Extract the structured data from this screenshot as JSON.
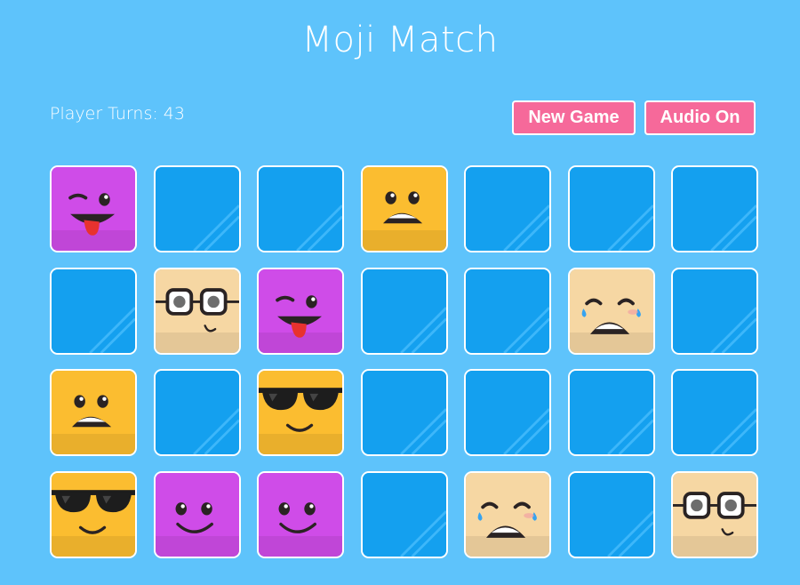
{
  "app": {
    "title": "Moji Match"
  },
  "status": {
    "turns_label": "Player Turns: 43"
  },
  "controls": {
    "new_game_label": "New Game",
    "audio_label": "Audio On"
  },
  "colors": {
    "background": "#5ec3fb",
    "card_back": "#14a0ef",
    "button": "#f6699a",
    "purple": "#cf4ce8",
    "yellow": "#fbbd30",
    "tan": "#f6d7a3"
  },
  "board": {
    "columns": 7,
    "rows": 4,
    "cards": [
      {
        "face": "wink-tongue",
        "revealed": true
      },
      {
        "face": "hidden",
        "revealed": false
      },
      {
        "face": "hidden",
        "revealed": false
      },
      {
        "face": "shocked",
        "revealed": true
      },
      {
        "face": "hidden",
        "revealed": false
      },
      {
        "face": "hidden",
        "revealed": false
      },
      {
        "face": "hidden",
        "revealed": false
      },
      {
        "face": "hidden",
        "revealed": false
      },
      {
        "face": "nerd-glasses",
        "revealed": true
      },
      {
        "face": "wink-tongue",
        "revealed": true
      },
      {
        "face": "hidden",
        "revealed": false
      },
      {
        "face": "hidden",
        "revealed": false
      },
      {
        "face": "crying",
        "revealed": true
      },
      {
        "face": "hidden",
        "revealed": false
      },
      {
        "face": "shocked",
        "revealed": true
      },
      {
        "face": "hidden",
        "revealed": false
      },
      {
        "face": "sunglasses",
        "revealed": true
      },
      {
        "face": "hidden",
        "revealed": false
      },
      {
        "face": "hidden",
        "revealed": false
      },
      {
        "face": "hidden",
        "revealed": false
      },
      {
        "face": "hidden",
        "revealed": false
      },
      {
        "face": "sunglasses",
        "revealed": true
      },
      {
        "face": "smile",
        "revealed": true
      },
      {
        "face": "smile",
        "revealed": true
      },
      {
        "face": "hidden",
        "revealed": false
      },
      {
        "face": "crying",
        "revealed": true
      },
      {
        "face": "hidden",
        "revealed": false
      },
      {
        "face": "nerd-glasses",
        "revealed": true
      }
    ]
  }
}
